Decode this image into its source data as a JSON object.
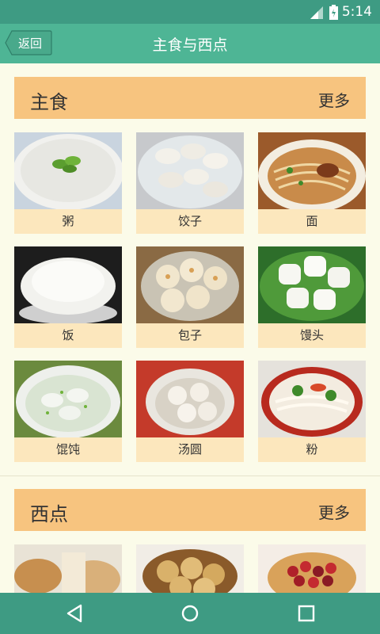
{
  "status_bar": {
    "time": "5:14"
  },
  "header": {
    "back_label": "返回",
    "title": "主食与西点"
  },
  "sections": [
    {
      "title": "主食",
      "more_label": "更多",
      "items": [
        {
          "label": "粥"
        },
        {
          "label": "饺子"
        },
        {
          "label": "面"
        },
        {
          "label": "饭"
        },
        {
          "label": "包子"
        },
        {
          "label": "馒头"
        },
        {
          "label": "馄饨"
        },
        {
          "label": "汤圆"
        },
        {
          "label": "粉"
        }
      ]
    },
    {
      "title": "西点",
      "more_label": "更多",
      "items": [
        {
          "label": ""
        },
        {
          "label": ""
        },
        {
          "label": ""
        }
      ]
    }
  ]
}
